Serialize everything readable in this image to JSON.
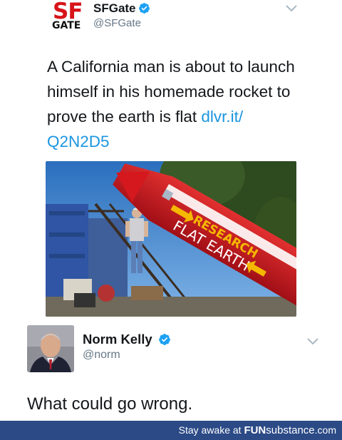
{
  "tweet": {
    "logo": {
      "line1": "SF",
      "line2": "GATE"
    },
    "author_name": "SFGate",
    "author_handle": "@SFGate",
    "text_before_link": "A California man is about to launch himself in his homemade rocket to prove the earth is flat ",
    "link_text": "dlvr.it/ Q2N2D5",
    "photo": {
      "rocket_text_1": "RESEARCH",
      "rocket_text_2": "FLAT EARTH"
    }
  },
  "reply": {
    "author_name": "Norm Kelly",
    "author_handle": "@norm",
    "text": "What could go wrong."
  },
  "footer": {
    "prefix": "Stay awake at ",
    "brand_part1": "FUN",
    "brand_part2": "substance",
    "brand_part3": ".com"
  },
  "colors": {
    "verified_blue": "#1da1f2",
    "link_blue": "#1b95e0",
    "sfgate_red": "#d7141a",
    "footer_bg": "#2b4a86"
  },
  "icons": {
    "verified": "verified-badge-icon",
    "chevron": "chevron-down-icon"
  }
}
